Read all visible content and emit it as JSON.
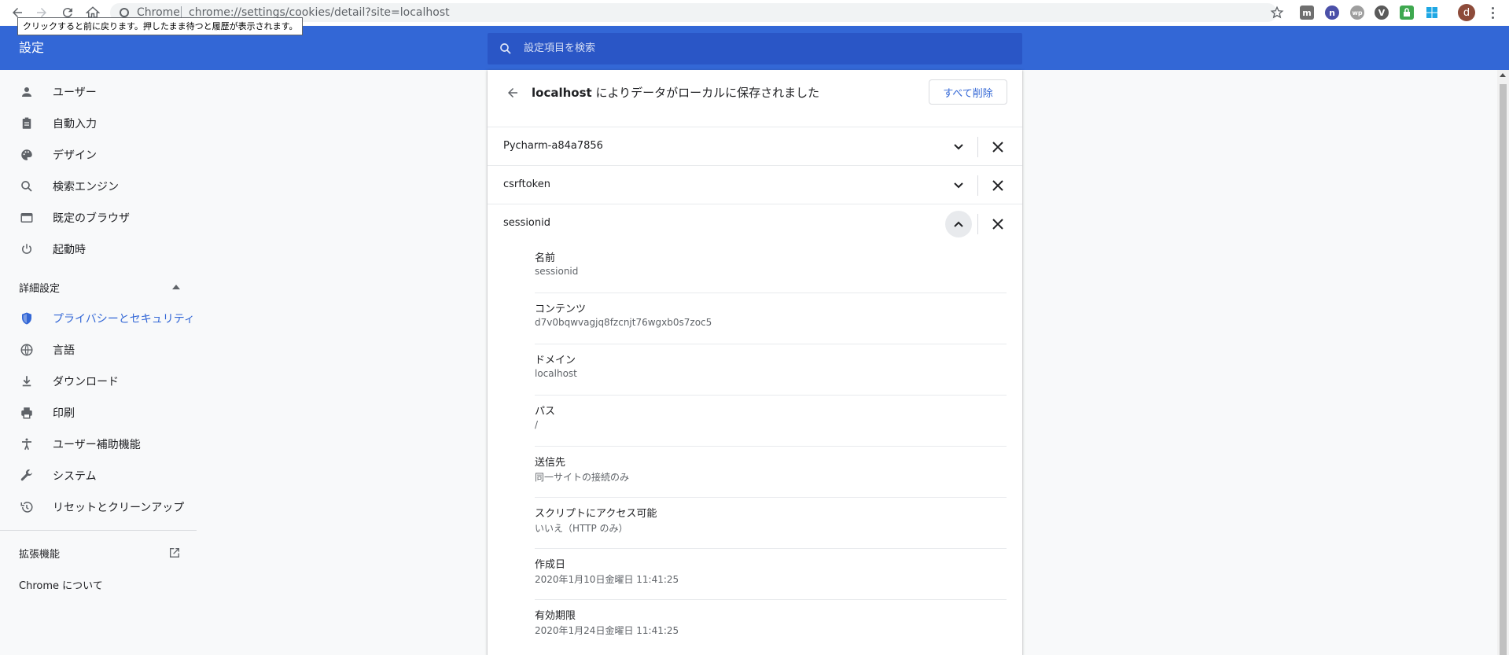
{
  "browser": {
    "omnibox_chip": "Chrome",
    "url": "chrome://settings/cookies/detail?site=localhost",
    "avatar_letter": "d",
    "tooltip": "クリックすると前に戻ります。押したまま待つと履歴が表示されます。",
    "extensions": [
      "m",
      "n",
      "wp",
      "V",
      "lock",
      "win"
    ]
  },
  "header": {
    "title": "設定",
    "search_placeholder": "設定項目を検索"
  },
  "sidebar": {
    "items": [
      {
        "label": "ユーザー",
        "icon": "person-icon"
      },
      {
        "label": "自動入力",
        "icon": "clipboard-icon"
      },
      {
        "label": "デザイン",
        "icon": "palette-icon"
      },
      {
        "label": "検索エンジン",
        "icon": "search-icon"
      },
      {
        "label": "既定のブラウザ",
        "icon": "browser-icon"
      },
      {
        "label": "起動時",
        "icon": "power-icon"
      }
    ],
    "advanced_label": "詳細設定",
    "advanced_items": [
      {
        "label": "プライバシーとセキュリティ",
        "icon": "shield-icon",
        "active": true
      },
      {
        "label": "言語",
        "icon": "globe-icon"
      },
      {
        "label": "ダウンロード",
        "icon": "download-icon"
      },
      {
        "label": "印刷",
        "icon": "printer-icon"
      },
      {
        "label": "ユーザー補助機能",
        "icon": "accessibility-icon"
      },
      {
        "label": "システム",
        "icon": "wrench-icon"
      },
      {
        "label": "リセットとクリーンアップ",
        "icon": "history-icon"
      }
    ],
    "extensions_label": "拡張機能",
    "about_label": "Chrome について"
  },
  "card": {
    "site": "localhost",
    "title_suffix": " によりデータがローカルに保存されました",
    "remove_all_label": "すべて削除",
    "cookies": [
      {
        "name": "Pycharm-a84a7856",
        "expanded": false
      },
      {
        "name": "csrftoken",
        "expanded": false
      },
      {
        "name": "sessionid",
        "expanded": true
      }
    ],
    "details": [
      {
        "label": "名前",
        "value": "sessionid"
      },
      {
        "label": "コンテンツ",
        "value": "d7v0bqwvagjq8fzcnjt76wgxb0s7zoc5"
      },
      {
        "label": "ドメイン",
        "value": "localhost"
      },
      {
        "label": "パス",
        "value": "/"
      },
      {
        "label": "送信先",
        "value": "同一サイトの接続のみ"
      },
      {
        "label": "スクリプトにアクセス可能",
        "value": "いいえ（HTTP のみ）"
      },
      {
        "label": "作成日",
        "value": "2020年1月10日金曜日 11:41:25"
      },
      {
        "label": "有効期限",
        "value": "2020年1月24日金曜日 11:41:25"
      }
    ]
  },
  "colors": {
    "header_blue": "#3367d6",
    "search_blue": "#2a56c6",
    "active_text": "#3367d6"
  }
}
